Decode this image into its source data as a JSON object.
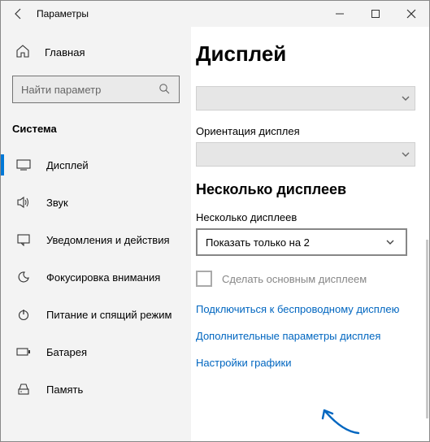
{
  "window": {
    "title": "Параметры"
  },
  "sidebar": {
    "home": "Главная",
    "search_placeholder": "Найти параметр",
    "section": "Система",
    "items": [
      {
        "label": "Дисплей"
      },
      {
        "label": "Звук"
      },
      {
        "label": "Уведомления и действия"
      },
      {
        "label": "Фокусировка внимания"
      },
      {
        "label": "Питание и спящий режим"
      },
      {
        "label": "Батарея"
      },
      {
        "label": "Память"
      }
    ]
  },
  "content": {
    "page_title": "Дисплей",
    "orientation_label": "Ориентация дисплея",
    "multi_heading": "Несколько дисплеев",
    "multi_label": "Несколько дисплеев",
    "multi_selected": "Показать только на 2",
    "make_main_label": "Сделать основным дисплеем",
    "links": {
      "wireless": "Подключиться к беспроводному дисплею",
      "advanced": "Дополнительные параметры дисплея",
      "graphics": "Настройки графики"
    }
  }
}
